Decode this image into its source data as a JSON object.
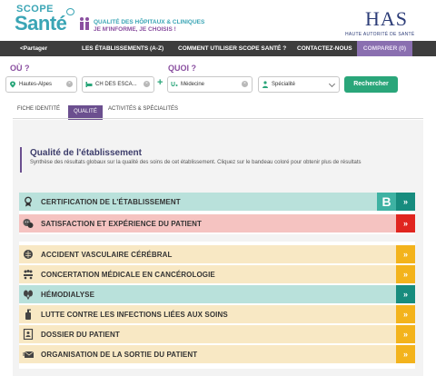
{
  "header": {
    "logo_top": "SCOPE",
    "logo_main": "Santé",
    "tagline_line1": "QUALITÉ DES HÔPITAUX & CLINIQUES",
    "tagline_line2": "JE M'INFORME, JE CHOISIS !",
    "has_logo": "HAS",
    "has_subtitle": "HAUTE AUTORITÉ DE SANTÉ"
  },
  "nav": {
    "share": "Partager",
    "establishments": "LES ÉTABLISSEMENTS (A-Z)",
    "how_to": "COMMENT UTILISER SCOPE SANTÉ ?",
    "contact": "CONTACTEZ-NOUS",
    "compare": "COMPARER (0)"
  },
  "search": {
    "where_label": "OÙ ?",
    "what_label": "QUOI ?",
    "location_value": "Hautes-Alpes",
    "establishment_value": "CH DES ESCA...",
    "specialty_value": "Médecine",
    "specialty_placeholder": "Spécialité",
    "search_button": "Rechercher"
  },
  "tabs": {
    "identity": "FICHE IDENTITÉ",
    "quality": "QUALITÉ",
    "activities": "ACTIVITÉS & SPÉCIALITÉS"
  },
  "quality": {
    "title": "Qualité de l'établissement",
    "subtitle": "Synthèse des résultats globaux sur la qualité des soins de cet établissement. Cliquez sur le bandeau coloré pour obtenir plus de résultats"
  },
  "indicators_top": [
    {
      "label": "CERTIFICATION DE L'ÉTABLISSEMENT",
      "grade": "B",
      "icon": "ribbon-icon",
      "color": "teal"
    },
    {
      "label": "SATISFACTION ET EXPÉRIENCE DU PATIENT",
      "icon": "satisfaction-icon",
      "color": "pink"
    }
  ],
  "indicators_bottom": [
    {
      "label": "ACCIDENT VASCULAIRE CÉRÉBRAL",
      "icon": "brain-icon",
      "color": "yellow"
    },
    {
      "label": "CONCERTATION MÉDICALE EN CANCÉROLOGIE",
      "icon": "meeting-icon",
      "color": "yellow"
    },
    {
      "label": "HÉMODIALYSE",
      "icon": "kidney-icon",
      "color": "teal"
    },
    {
      "label": "LUTTE CONTRE LES INFECTIONS LIÉES AUX SOINS",
      "icon": "sanitizer-icon",
      "color": "yellow"
    },
    {
      "label": "DOSSIER DU PATIENT",
      "icon": "patient-file-icon",
      "color": "yellow"
    },
    {
      "label": "ORGANISATION DE LA SORTIE DU PATIENT",
      "icon": "letter-icon",
      "color": "yellow"
    }
  ],
  "colors": {
    "brand_teal": "#3aa5b5",
    "brand_purple": "#8a4fa0",
    "green": "#2aa67a",
    "teal_row": "#b9e1db",
    "pink_row": "#f5c3c1",
    "yellow_row": "#f8e8c4"
  }
}
